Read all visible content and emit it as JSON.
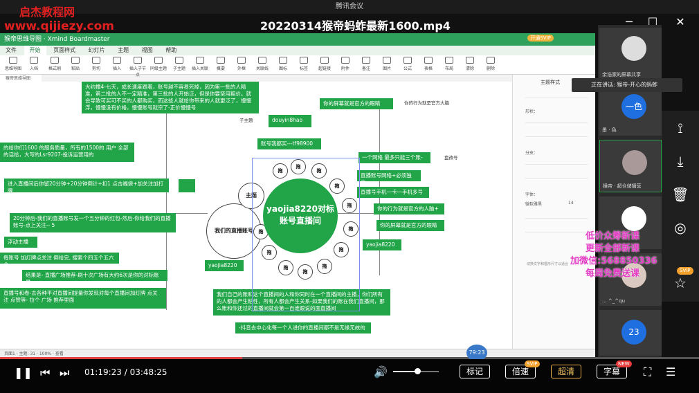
{
  "window": {
    "app_title": "腾讯会议",
    "video_title": "20220314猴帝蚂蚱最新1600.mp4"
  },
  "watermark": {
    "site_name": "启杰教程网",
    "site_url": "www.qijiezy.com"
  },
  "wps": {
    "title": "猴帝思维导图 · Xmind Boardmaster",
    "tabs": [
      "文件",
      "开始",
      "页面样式",
      "幻灯片",
      "主题",
      "视图",
      "帮助"
    ],
    "active_tab": "开始",
    "vip": "开通SVIP",
    "ribbon": [
      "思维导图",
      "入档",
      "格式刷",
      "粘贴",
      "剪切",
      "插入",
      "插入子节点",
      "同级主题",
      "子主题",
      "插入关联",
      "概要",
      "外框",
      "关联线",
      "图标",
      "标签",
      "超链接",
      "附件",
      "备注",
      "图片",
      "公式",
      "表格",
      "布局",
      "清除",
      "删除"
    ],
    "doc_tab": "猴帝思维导图",
    "right_panel_title": "主题样式",
    "right_panel_labels": [
      "形状：",
      "分支：",
      "字体："
    ],
    "font_name": "微软雅黑",
    "font_size": "14",
    "right_panel_note": "切换文字和框形尺寸以适合",
    "status": "页面1 · 主题: 31 · 100% · 查看"
  },
  "mindmap": {
    "hub": "yaojia8220对标账号直播间",
    "left_circle": "我们的直播账号",
    "topic_circle": "主题",
    "petal": "拖",
    "nodes": {
      "n_top": "大约播4-七天，成长速度跟着，账号越不容易死掉，因为第一批的人精准，第二批的人不一定精准，第三批的人开始泛，但是你要坚用粗价。就会导致可买可不买的人都购买，而这些人就给你带来的人就更泛了，慢慢浮，慢慢没有价格，慢慢账号就宗了-正价慢慢号",
      "n_left1": "的给你们1600 的服务质量，所有的1500的 用户 全部的话给，大写的Lsr9207-投诉运营用的",
      "n_left2": "进入直播间后你留20分钟+20分钟倒计+扣1 点击福袋+加关注加打牌",
      "n_left3": "20分钟后-我们的直播账号发一个五分钟的红包-然后-你给我们的直播账号-点上关注-- 5",
      "n_left4": "浮动主播",
      "n_left5": "每账号 加灯牌点关注 倒给完, 搜索个四五个五六个",
      "n_left6": "结果是- 直播广场推荐-刷十次广场有大约6次是你的对标账号",
      "n_left7": "直播号和卷-去各种平对直播间提量你发现对每个直播间加灯牌 点关注 点赞等- 拉个 广场 推荐里面",
      "n_douyin": "douyin8hao",
      "n_shuliang": "账号我都买---tf98900",
      "n_yaojia_l": "yaojia8220",
      "n_yaojia_r": "yaojia8220",
      "n_r1": "你的屏幕就是官方的眼睛",
      "n_r2": "一个网络 最多只能三个账-",
      "n_r3": "直播账号网络+必须独立-",
      "n_r4": "直播号手机一卡一手机多号",
      "n_r5": "你的行为就是官方的人脑+",
      "n_r6": "你的屏幕就是官方的眼睛",
      "n_bottom": "我们自己的账和这个直播间的人和你同时在一个直播间的主播，你们所有的人都会产生粘性，所有人都会产生关系-如果我们的账在我们直播间，那么账和你还过的直播间就会第一百谁跟说的面直播间",
      "n_bottom2": "-抖音去中心化每一个人进你的直播间都不是无缘无故的"
    },
    "plain": {
      "p1": "你的行为就是官方大脑",
      "p2": "子主题",
      "p3": "盘改号"
    }
  },
  "participants": [
    {
      "name": "余浩家的屏幕共享",
      "avatar": ""
    },
    {
      "name": "墨 · 色",
      "avatar": "一色"
    },
    {
      "name": "猴帝 · 超仓储播营",
      "avatar": ""
    },
    {
      "name": "... ^_^qu",
      "avatar": ""
    },
    {
      "name": "",
      "avatar": "23"
    }
  ],
  "speaking_text": "正在讲话: 猴帝-开心的蚂蚱",
  "promo": [
    "低价众筹新课",
    "更新全部新课",
    "加微信:568850336",
    "每周免费送课"
  ],
  "player": {
    "current_time": "01:19:23",
    "total_time": "03:48:25",
    "separator": "/",
    "hover_time": "79:23",
    "progress": 0.347,
    "volume": 0.53,
    "buttons": {
      "bookmark": "标记",
      "speed": "倍速",
      "quality": "超清",
      "subtitle": "字幕"
    },
    "badges": {
      "speed": "SVIP",
      "subtitle": "NEW",
      "side": "SVIP"
    }
  },
  "colors": {
    "accent_green": "#21a548",
    "promo_pink": "#e33cc4",
    "watermark_red": "#e02020",
    "progress": "#e04040"
  }
}
